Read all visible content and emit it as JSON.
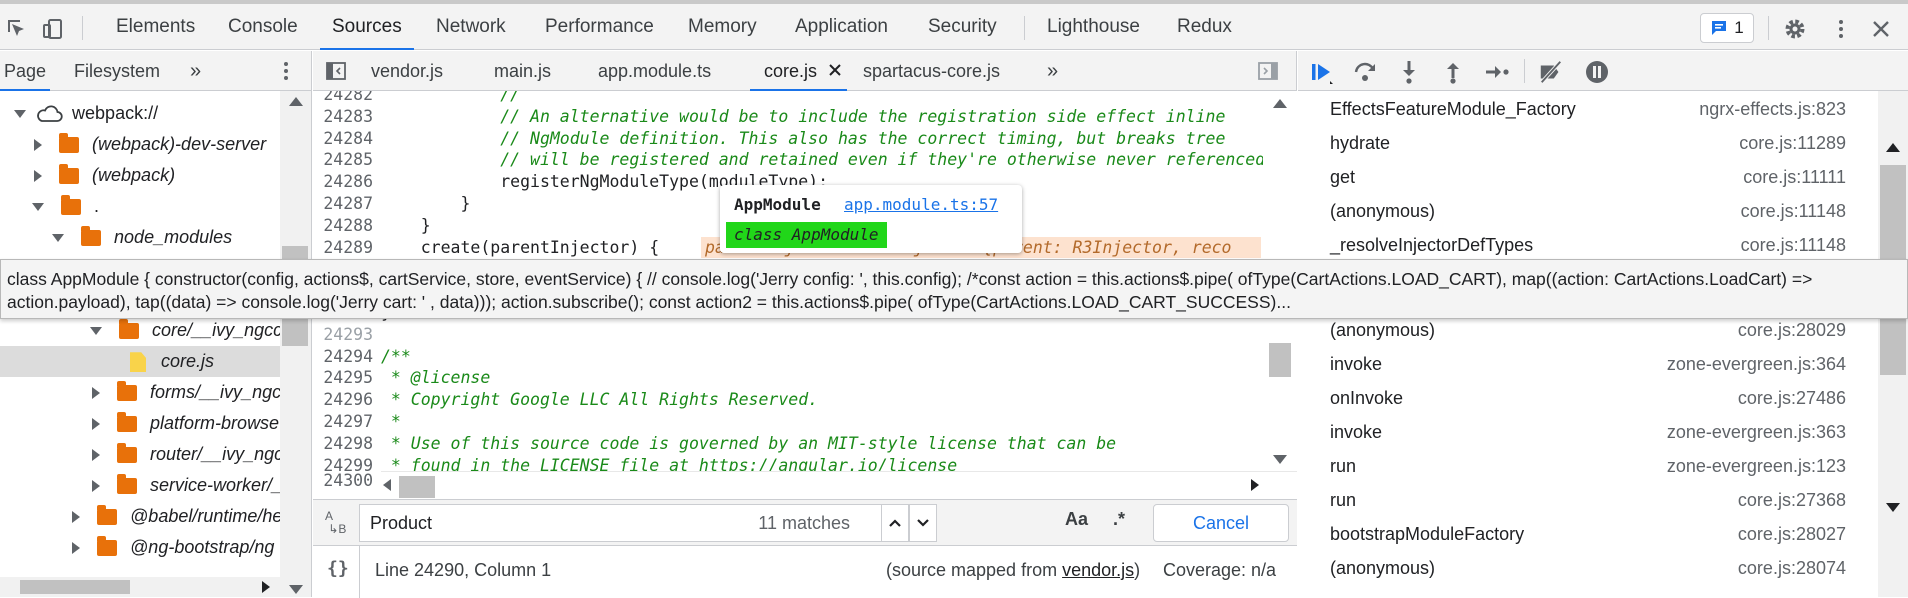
{
  "toolbar": {
    "tabs": [
      "Elements",
      "Console",
      "Sources",
      "Network",
      "Performance",
      "Memory",
      "Application",
      "Security",
      "Lighthouse",
      "Redux"
    ],
    "active_tab": "Sources",
    "issues_count": "1"
  },
  "navigator": {
    "tabs": [
      "Page",
      "Filesystem"
    ],
    "more": "»",
    "tree": [
      {
        "label": "webpack://",
        "italic": false,
        "icon": "cloud-icon",
        "expanded": true
      },
      {
        "label": "(webpack)-dev-server",
        "italic": true,
        "icon": "folder-icon",
        "expanded": false
      },
      {
        "label": "(webpack)",
        "italic": true,
        "icon": "folder-icon",
        "expanded": false
      },
      {
        "label": ".",
        "italic": false,
        "icon": "folder-icon",
        "expanded": true
      },
      {
        "label": "node_modules",
        "italic": true,
        "icon": "folder-icon",
        "expanded": true
      },
      {
        "label": "core/__ivy_ngcc_",
        "italic": true,
        "icon": "folder-icon",
        "expanded": true
      },
      {
        "label": "core.js",
        "italic": true,
        "icon": "js-file-icon",
        "selected": true
      },
      {
        "label": "forms/__ivy_ngcc",
        "italic": true,
        "icon": "folder-icon",
        "expanded": false
      },
      {
        "label": "platform-browse",
        "italic": true,
        "icon": "folder-icon",
        "expanded": false
      },
      {
        "label": "router/__ivy_ngcc",
        "italic": true,
        "icon": "folder-icon",
        "expanded": false
      },
      {
        "label": "service-worker/_",
        "italic": true,
        "icon": "folder-icon",
        "expanded": false
      },
      {
        "label": "@babel/runtime/he",
        "italic": true,
        "icon": "folder-icon",
        "expanded": false
      },
      {
        "label": "@ng-bootstrap/ng",
        "italic": true,
        "icon": "folder-icon",
        "expanded": false
      }
    ]
  },
  "editor": {
    "tabs": [
      "vendor.js",
      "main.js",
      "app.module.ts",
      "core.js",
      "spartacus-core.js"
    ],
    "active_tab": "core.js",
    "more": "»",
    "lines": [
      {
        "num": "24282",
        "text": "            //"
      },
      {
        "num": "24283",
        "text": "            // An alternative would be to include the registration side effect inline"
      },
      {
        "num": "24284",
        "text": "            // NgModule definition. This also has the correct timing, but breaks tree"
      },
      {
        "num": "24285",
        "text": "            // will be registered and retained even if they're otherwise never referenced"
      },
      {
        "num": "24286",
        "text": "            registerNgModuleType(moduleType);"
      },
      {
        "num": "24287",
        "text": "        }"
      },
      {
        "num": "24288",
        "text": "    }"
      },
      {
        "num": "24289",
        "text": "    create(parentInjector) {"
      },
      {
        "num": "24290",
        "text": ""
      },
      {
        "num": "24291",
        "text": ""
      },
      {
        "num": "24292",
        "text": "}"
      },
      {
        "num": "24293",
        "text": ""
      },
      {
        "num": "24294",
        "text": "/**"
      },
      {
        "num": "24295",
        "text": " * @license"
      },
      {
        "num": "24296",
        "text": " * Copyright Google LLC All Rights Reserved."
      },
      {
        "num": "24297",
        "text": " *"
      },
      {
        "num": "24298",
        "text": " * Use of this source code is governed by an MIT-style license that can be"
      },
      {
        "num": "24299",
        "text": " * found in the LICENSE file at https://angular.io/license"
      },
      {
        "num": "24300",
        "text": ""
      }
    ],
    "inline_value": "parentInjector = R3Injector {parent: R3Injector, reco"
  },
  "search": {
    "query": "Product",
    "matches": "11 matches",
    "case_label": "Aa",
    "regex_label": ".*",
    "cancel_label": "Cancel"
  },
  "status": {
    "braces": "{}",
    "position": "Line 24290, Column 1",
    "source_mapped_prefix": "(source mapped from ",
    "source_mapped_file": "vendor.js",
    "source_mapped_suffix": ")",
    "coverage": "Coverage: n/a"
  },
  "callstack": [
    {
      "name": "EffectsFeatureModule_Factory",
      "loc": "ngrx-effects.js:823"
    },
    {
      "name": "hydrate",
      "loc": "core.js:11289"
    },
    {
      "name": "get",
      "loc": "core.js:11111"
    },
    {
      "name": "(anonymous)",
      "loc": "core.js:11148"
    },
    {
      "name": "_resolveInjectorDefTypes",
      "loc": "core.js:11148"
    },
    {
      "name": "(anonymous)",
      "loc": "core.js:28029"
    },
    {
      "name": "invoke",
      "loc": "zone-evergreen.js:364"
    },
    {
      "name": "onInvoke",
      "loc": "core.js:27486"
    },
    {
      "name": "invoke",
      "loc": "zone-evergreen.js:363"
    },
    {
      "name": "run",
      "loc": "zone-evergreen.js:123"
    },
    {
      "name": "run",
      "loc": "core.js:27368"
    },
    {
      "name": "bootstrapModuleFactory",
      "loc": "core.js:28027"
    },
    {
      "name": "(anonymous)",
      "loc": "core.js:28074"
    }
  ],
  "popover": {
    "name": "AppModule",
    "link": "app.module.ts:57",
    "value": "class AppModule"
  },
  "tooltip": {
    "text": "class AppModule { constructor(config, actions$, cartService, store, eventService) { // console.log('Jerry config: ', this.config); /*const action = this.actions$.pipe( ofType(CartActions.LOAD_CART), map((action: CartActions.LoadCart) => action.payload), tap((data) => console.log('Jerry cart: ' , data))); action.subscribe(); const action2 = this.actions$.pipe( ofType(CartActions.LOAD_CART_SUCCESS)..."
  },
  "colors": {
    "accent": "#1a73e8",
    "folder": "#e8710a",
    "comment": "#1a8a19",
    "keyword": "#8a1299",
    "value_highlight": "#21d619"
  }
}
